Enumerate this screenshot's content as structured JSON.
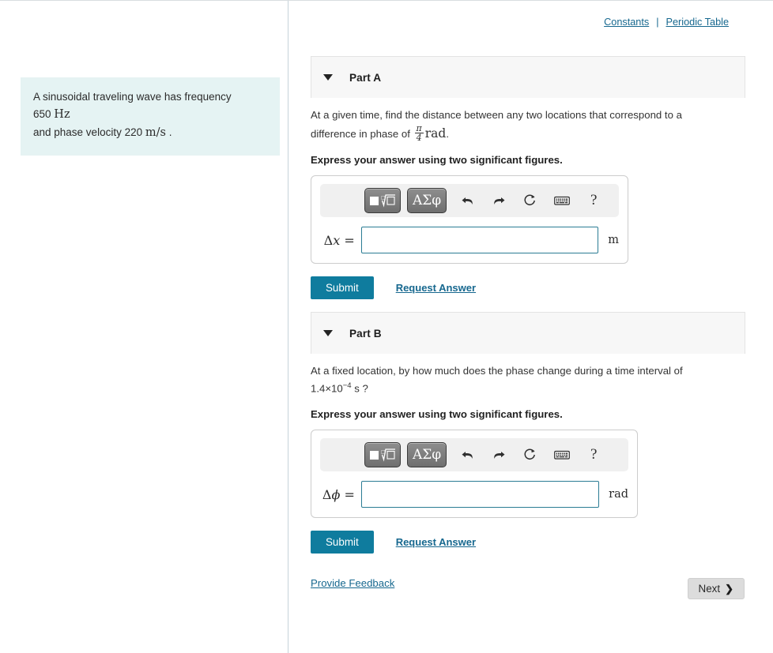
{
  "top_links": {
    "constants": "Constants",
    "separator": "|",
    "periodic_table": "Periodic Table"
  },
  "problem_statement": {
    "line1_prefix": "A sinusoidal traveling wave has frequency ",
    "frequency_value": "650",
    "frequency_unit": "Hz",
    "line2_prefix": "and phase velocity ",
    "velocity_value": "220",
    "velocity_unit": "m/s",
    "line2_suffix": "."
  },
  "math_toolbar": {
    "template_button_name": "math-template-button",
    "greek_button_label": "ΑΣφ",
    "undo_name": "undo-icon",
    "redo_name": "redo-icon",
    "reset_name": "reset-icon",
    "keyboard_name": "keyboard-icon",
    "help_label": "?"
  },
  "parts": [
    {
      "id": "part-a",
      "title": "Part A",
      "question_pre": "At a given time, find the distance between any two locations that correspond to a difference in phase of ",
      "fraction_numerator": "π",
      "fraction_denominator": "4",
      "question_unit": "rad",
      "question_post": ".",
      "instruction": "Express your answer using two significant figures.",
      "variable_symbol": "Δ",
      "variable_italic": "x",
      "variable_equals": "=",
      "input_value": "",
      "input_placeholder": "",
      "answer_unit": "m",
      "submit_label": "Submit",
      "request_answer_label": "Request Answer"
    },
    {
      "id": "part-b",
      "title": "Part B",
      "question_pre": "At a fixed location, by how much does the phase change during a time interval of ",
      "time_mantissa": "1.4×10",
      "time_exponent": "−4",
      "time_unit": "s",
      "question_post": " ?",
      "instruction": "Express your answer using two significant figures.",
      "variable_symbol": "Δ",
      "variable_italic": "ϕ",
      "variable_equals": "=",
      "input_value": "",
      "input_placeholder": "",
      "answer_unit": "rad",
      "submit_label": "Submit",
      "request_answer_label": "Request Answer"
    }
  ],
  "footer": {
    "feedback_label": "Provide Feedback",
    "next_label": "Next",
    "next_chevron": "❯"
  },
  "colors": {
    "accent_teal": "#0f7c9e",
    "link_blue": "#17688f",
    "problem_bg": "#e5f3f3",
    "part_header_bg": "#f7f7f7",
    "input_border": "#2b7c94",
    "next_bg": "#dcdcdc"
  }
}
